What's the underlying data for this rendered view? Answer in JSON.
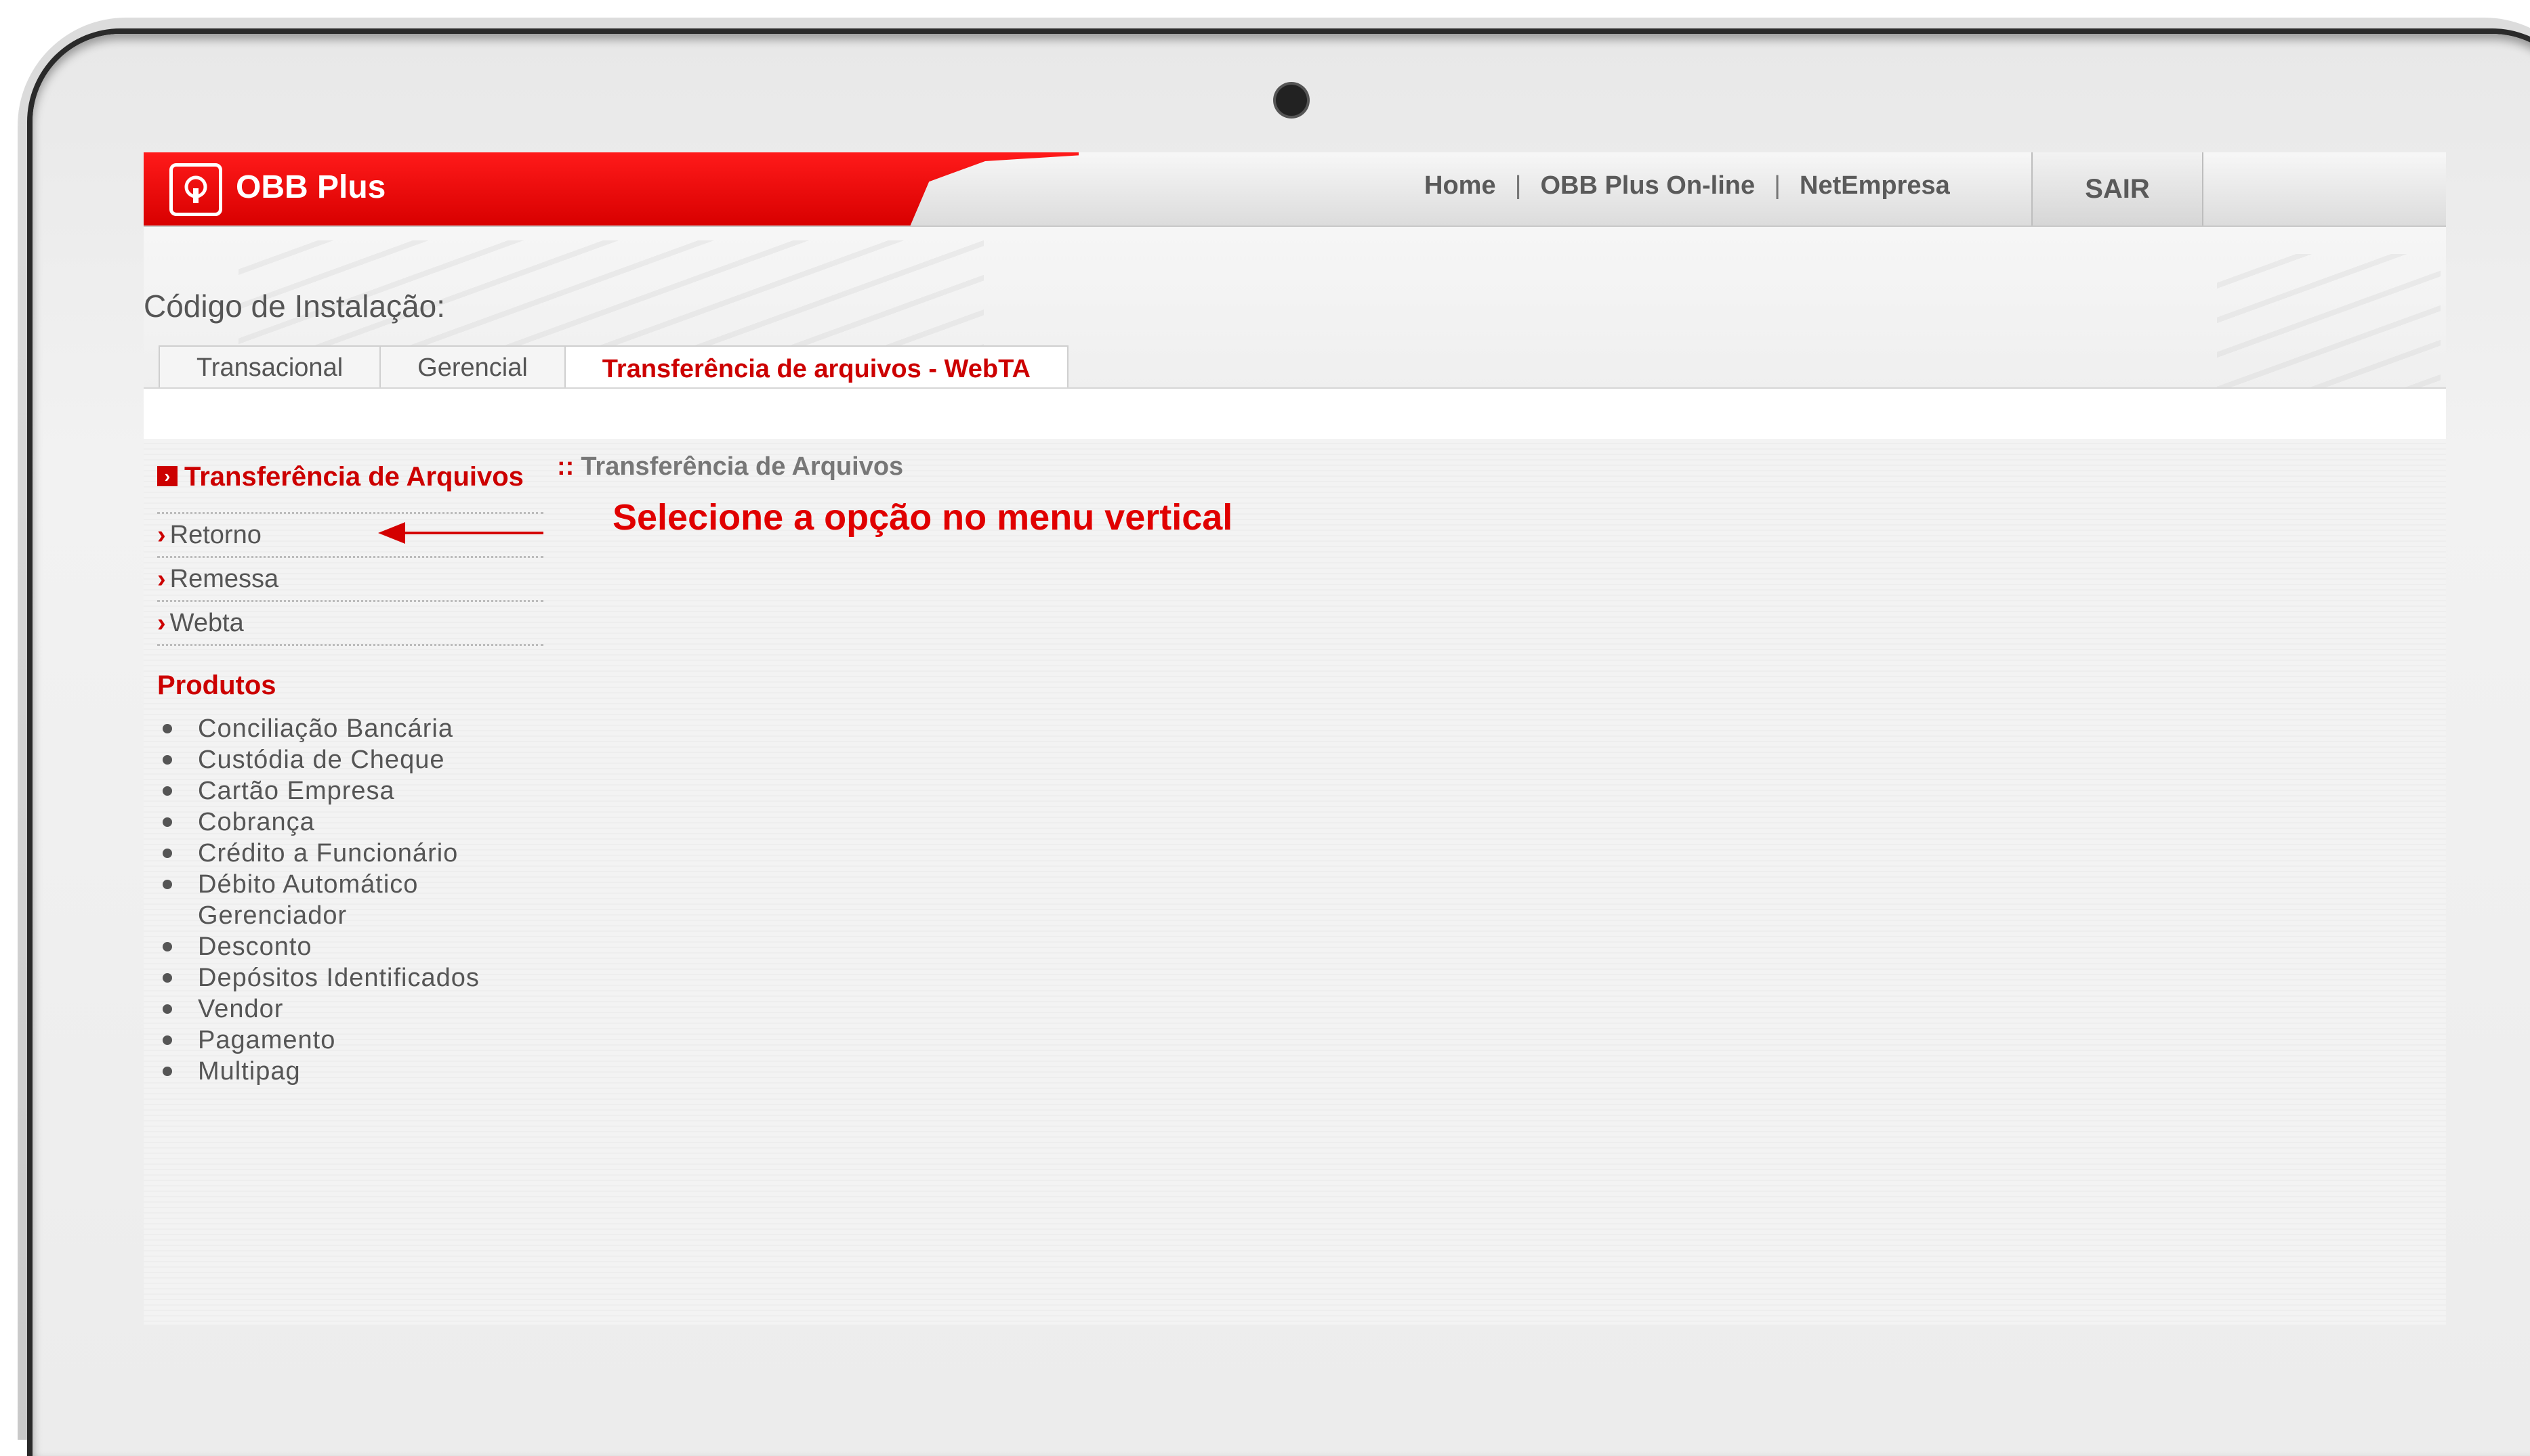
{
  "header": {
    "brand": "OBB Plus",
    "nav": [
      "Home",
      "OBB Plus On-line",
      "NetEmpresa"
    ],
    "nav_separator": "|",
    "exit": "SAIR"
  },
  "install_label": "Código de Instalação:",
  "tabs": [
    {
      "label": "Transacional",
      "active": false
    },
    {
      "label": "Gerencial",
      "active": false
    },
    {
      "label": "Transferência de arquivos - WebTA",
      "active": true
    }
  ],
  "sidebar": {
    "section_title": "Transferência de Arquivos",
    "menu": [
      "Retorno",
      "Remessa",
      "Webta"
    ],
    "products_title": "Produtos",
    "products": [
      "Conciliação Bancária",
      "Custódia de Cheque",
      "Cartão Empresa",
      "Cobrança",
      "Crédito a Funcionário",
      "Débito Automático Gerenciador",
      "Desconto",
      "Depósitos Identificados",
      "Vendor",
      "Pagamento",
      "Multipag"
    ]
  },
  "main": {
    "breadcrumb": "Transferência de Arquivos",
    "instruction": "Selecione a opção no menu vertical"
  },
  "colors": {
    "accent": "#cc0000",
    "text": "#555555"
  },
  "icons": [
    "obb-logo-icon",
    "section-icon",
    "chevron-right-icon",
    "arrow-left-icon",
    "camera-icon"
  ]
}
